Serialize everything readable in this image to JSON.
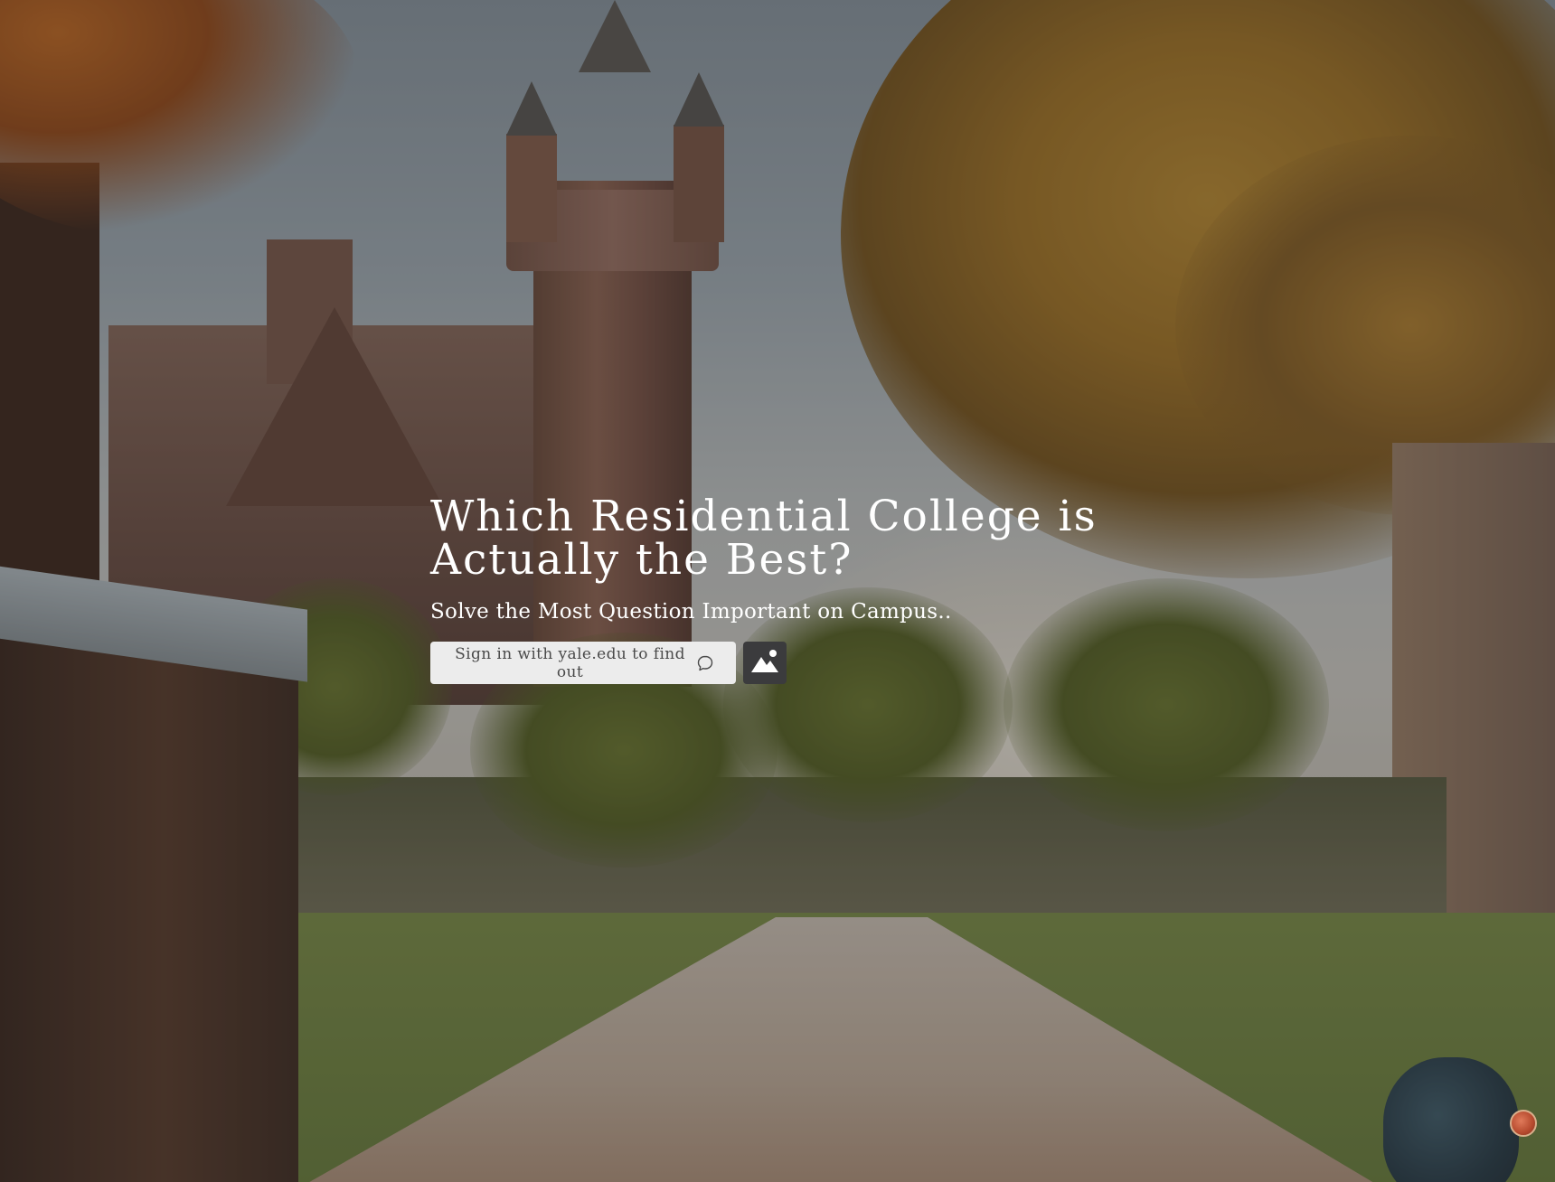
{
  "hero": {
    "title_line1": "Which Residential College is",
    "title_line2": "Actually the Best?",
    "subtitle": "Solve the Most Question Important on Campus.."
  },
  "actions": {
    "signin_label": "Sign in with yale.edu to find out",
    "signin_icon": "chat-bubble-icon",
    "image_button_icon": "image-icon"
  },
  "corner_badge_icon": "badge-icon",
  "colors": {
    "button_bg": "#ececec",
    "button_text": "#4a4a4a",
    "image_button_bg": "#3b3b3d",
    "title_text": "#ffffff"
  }
}
